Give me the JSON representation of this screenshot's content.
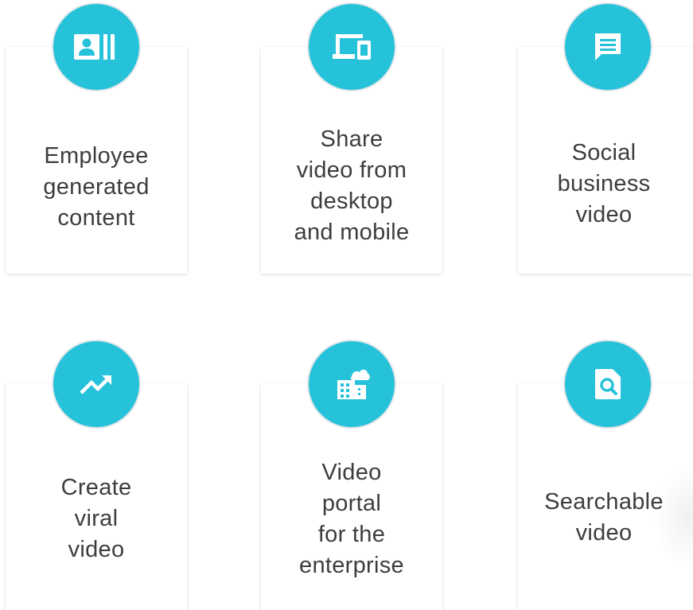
{
  "accent_color": "#25c2da",
  "features": [
    {
      "label": "Employee\ngenerated\ncontent",
      "icon": "contact-card-icon"
    },
    {
      "label": "Share\nvideo from\ndesktop\nand mobile",
      "icon": "devices-icon"
    },
    {
      "label": "Social\nbusiness\nvideo",
      "icon": "chat-message-icon"
    },
    {
      "label": "Create\nviral\nvideo",
      "icon": "trending-up-icon"
    },
    {
      "label": "Video\nportal\nfor the\nenterprise",
      "icon": "cloud-building-icon"
    },
    {
      "label": "Searchable\nvideo",
      "icon": "document-search-icon"
    }
  ]
}
